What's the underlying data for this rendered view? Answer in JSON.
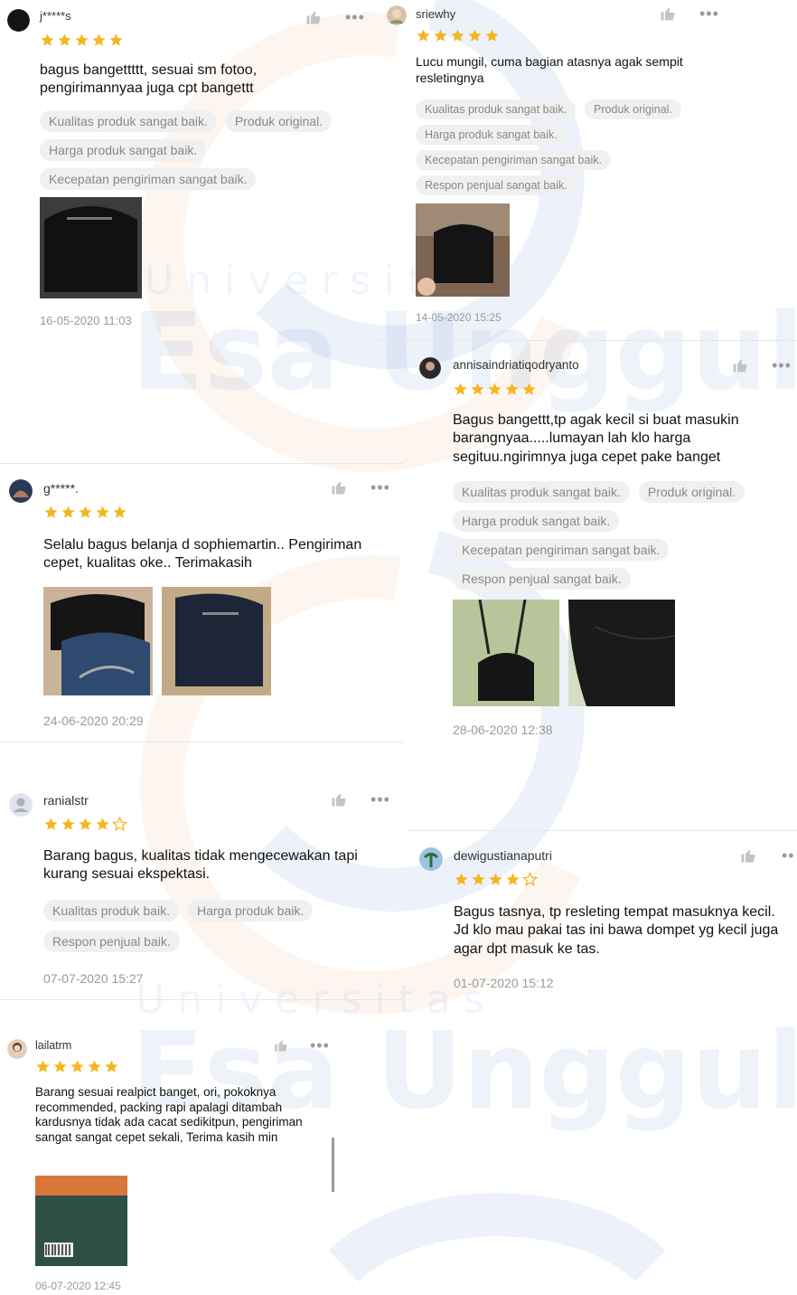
{
  "watermark": {
    "line1": "Universitas",
    "line2": "Esa Unggul"
  },
  "colors": {
    "star": "#f6b51e",
    "text": "#111111",
    "tag_bg": "#f0f0f0",
    "tag_text": "#888888",
    "date": "#9a9a9a",
    "watermark_blue": "#1e5fc4",
    "watermark_orange": "#f08a3c"
  },
  "icons": {
    "like": "thumbs-up-icon",
    "more": "more-dots-icon",
    "star": "star-icon"
  },
  "reviews": [
    {
      "username": "j*****s",
      "rating": 5,
      "text": "bagus bangettttt, sesuai sm fotoo, pengirimannyaa juga cpt bangettt",
      "tags": [
        "Kualitas produk sangat baik.",
        "Produk original.",
        "Harga produk sangat baik.",
        "Kecepatan pengiriman sangat baik."
      ],
      "photo_count": 1,
      "date": "16-05-2020 11:03",
      "more": "•••"
    },
    {
      "username": "sriewhy",
      "rating": 5,
      "text": "Lucu mungil, cuma bagian atasnya agak sempit resletingnya",
      "tags": [
        "Kualitas produk sangat baik.",
        "Produk original.",
        "Harga produk sangat baik.",
        "Kecepatan pengiriman sangat baik.",
        "Respon penjual sangat baik."
      ],
      "photo_count": 1,
      "date": "14-05-2020 15:25",
      "more": "•••"
    },
    {
      "username": "annisaindriatiqodryanto",
      "rating": 5,
      "text": "Bagus bangettt,tp agak kecil si buat masukin barangnyaa.....lumayan lah klo harga segituu.ngirimnya juga cepet pake banget",
      "tags": [
        "Kualitas produk sangat baik.",
        "Produk original.",
        "Harga produk sangat baik.",
        "Kecepatan pengiriman sangat baik.",
        "Respon penjual sangat baik."
      ],
      "photo_count": 2,
      "date": "28-06-2020 12:38",
      "more": "•••"
    },
    {
      "username": "g*****.",
      "rating": 5,
      "text": "Selalu bagus belanja d sophiemartin.. Pengiriman cepet, kualitas oke.. Terimakasih",
      "tags": [],
      "photo_count": 2,
      "date": "24-06-2020 20:29",
      "more": "•••"
    },
    {
      "username": "ranialstr",
      "rating": 4,
      "text": "Barang bagus, kualitas tidak mengecewakan tapi kurang sesuai ekspektasi.",
      "tags": [
        "Kualitas produk baik.",
        "Harga produk baik.",
        "Respon penjual baik."
      ],
      "photo_count": 0,
      "date": "07-07-2020 15:27",
      "more": "•••"
    },
    {
      "username": "dewigustianaputri",
      "rating": 4,
      "text": "Bagus tasnya, tp resleting tempat masuknya kecil. Jd klo mau pakai tas ini bawa dompet yg kecil juga agar dpt masuk ke tas.",
      "tags": [],
      "photo_count": 0,
      "date": "01-07-2020 15:12",
      "more": "••"
    },
    {
      "username": "lailatrm",
      "rating": 5,
      "text": "Barang sesuai realpict banget, ori, pokoknya recommended, packing rapi apalagi ditambah kardusnya tidak ada cacat sedikitpun, pengiriman sangat sangat cepet sekali, Terima kasih min",
      "tags": [],
      "photo_count": 1,
      "date": "06-07-2020 12:45",
      "more": "•••"
    }
  ]
}
